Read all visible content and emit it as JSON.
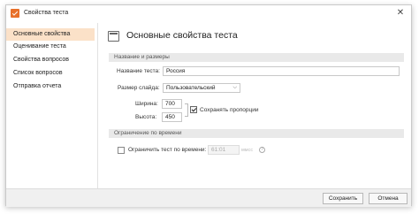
{
  "window": {
    "title": "Свойства теста"
  },
  "sidebar": {
    "items": [
      {
        "label": "Основные свойства"
      },
      {
        "label": "Оценивание теста"
      },
      {
        "label": "Свойства вопросов"
      },
      {
        "label": "Список вопросов"
      },
      {
        "label": "Отправка отчета"
      }
    ]
  },
  "main": {
    "title": "Основные свойства теста",
    "section_name_size": "Название и размеры",
    "test_name_label": "Название теста:",
    "test_name_value": "Россия",
    "slide_size_label": "Размер слайда:",
    "slide_size_value": "Пользовательский",
    "width_label": "Ширина:",
    "width_value": "700",
    "height_label": "Высота:",
    "height_value": "450",
    "keep_proportions_label": "Сохранять пропорции",
    "keep_proportions_checked": true,
    "section_time_limit": "Ограничение по времени",
    "time_limit_label": "Ограничить тест по времени:",
    "time_limit_checked": false,
    "time_limit_value": "61:01",
    "time_units": "ммсс",
    "help_symbol": "?"
  },
  "footer": {
    "save_label": "Сохранить",
    "cancel_label": "Отмена"
  },
  "colors": {
    "accent": "#e8702a",
    "active_item_bg": "#fbe1c8",
    "section_bar_bg": "#e9e9e9"
  }
}
